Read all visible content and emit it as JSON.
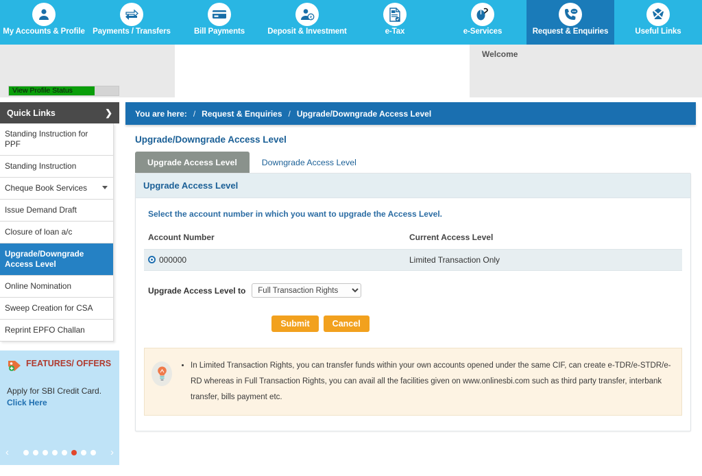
{
  "topnav": {
    "items": [
      {
        "label": "My Accounts & Profile",
        "icon": "user-icon",
        "active": false
      },
      {
        "label": "Payments / Transfers",
        "icon": "transfer-arrows-icon",
        "active": false
      },
      {
        "label": "Bill Payments",
        "icon": "card-icon",
        "active": false
      },
      {
        "label": "Deposit & Investment",
        "icon": "deposit-money-icon",
        "active": false
      },
      {
        "label": "e-Tax",
        "icon": "tax-document-icon",
        "active": false
      },
      {
        "label": "e-Services",
        "icon": "mouse-icon",
        "active": false
      },
      {
        "label": "Request & Enquiries",
        "icon": "phone-chat-icon",
        "active": true
      },
      {
        "label": "Useful Links",
        "icon": "links-icon",
        "active": false
      }
    ]
  },
  "header": {
    "profile_status_label": "View Profile Status",
    "welcome_text": "Welcome"
  },
  "sidebar": {
    "quick_links_title": "Quick Links",
    "quick_links_chevron": "❯",
    "items": [
      {
        "label": "Standing Instruction for PPF",
        "active": false,
        "caret": false
      },
      {
        "label": "Standing Instruction",
        "active": false,
        "caret": false
      },
      {
        "label": "Cheque Book Services",
        "active": false,
        "caret": true
      },
      {
        "label": "Issue Demand Draft",
        "active": false,
        "caret": false
      },
      {
        "label": "Closure of loan a/c",
        "active": false,
        "caret": false
      },
      {
        "label": "Upgrade/Downgrade Access Level",
        "active": true,
        "caret": false
      },
      {
        "label": "Online Nomination",
        "active": false,
        "caret": false
      },
      {
        "label": "Sweep Creation for CSA",
        "active": false,
        "caret": false
      },
      {
        "label": "Reprint EPFO Challan",
        "active": false,
        "caret": false
      }
    ],
    "features": {
      "title": "FEATURES/ OFFERS",
      "icon": "tag-offer-icon",
      "text": "Apply for SBI Credit Card.",
      "link_text": "Click Here",
      "carousel": {
        "prev_icon": "chevron-left-icon",
        "next_icon": "chevron-right-icon",
        "total_dots": 8,
        "active_dot": 6
      }
    }
  },
  "breadcrumb": {
    "prefix": "You are here:",
    "separator": "/",
    "items": [
      "Request & Enquiries",
      "Upgrade/Downgrade Access Level"
    ]
  },
  "main": {
    "page_title": "Upgrade/Downgrade Access Level",
    "tabs": [
      {
        "label": "Upgrade Access Level",
        "active": true
      },
      {
        "label": "Downgrade Access Level",
        "active": false
      }
    ],
    "card_title": "Upgrade Access Level",
    "select_hint": "Select the account number in which you want to upgrade the Access Level.",
    "table": {
      "headers": [
        "Account Number",
        "Current Access Level"
      ],
      "rows": [
        {
          "account_number": "000000",
          "current_access_level": "Limited Transaction Only",
          "selected": true
        }
      ]
    },
    "upgrade_label": "Upgrade Access Level to",
    "level_select": {
      "value": "Full Transaction Rights",
      "options": [
        "Full Transaction Rights"
      ]
    },
    "buttons": {
      "submit": "Submit",
      "cancel": "Cancel"
    },
    "note": {
      "icon": "lightbulb-icon",
      "text": "In Limited Transaction Rights, you can transfer funds within your own accounts opened under the same CIF, can create e-TDR/e-STDR/e-RD whereas in Full Transaction Rights, you can avail all the facilities given on www.onlinesbi.com such as third party transfer, interbank transfer, bills payment etc."
    }
  },
  "colors": {
    "nav_blue": "#29b6e3",
    "nav_active_blue": "#1a7bb9",
    "breadcrumb_blue": "#1a6fb0",
    "sidebar_active": "#2581c4",
    "button_orange": "#f2a11e",
    "note_bg": "#fdf3e3",
    "features_bg": "#bfe3f7",
    "progress_green": "#0a9e0a"
  }
}
